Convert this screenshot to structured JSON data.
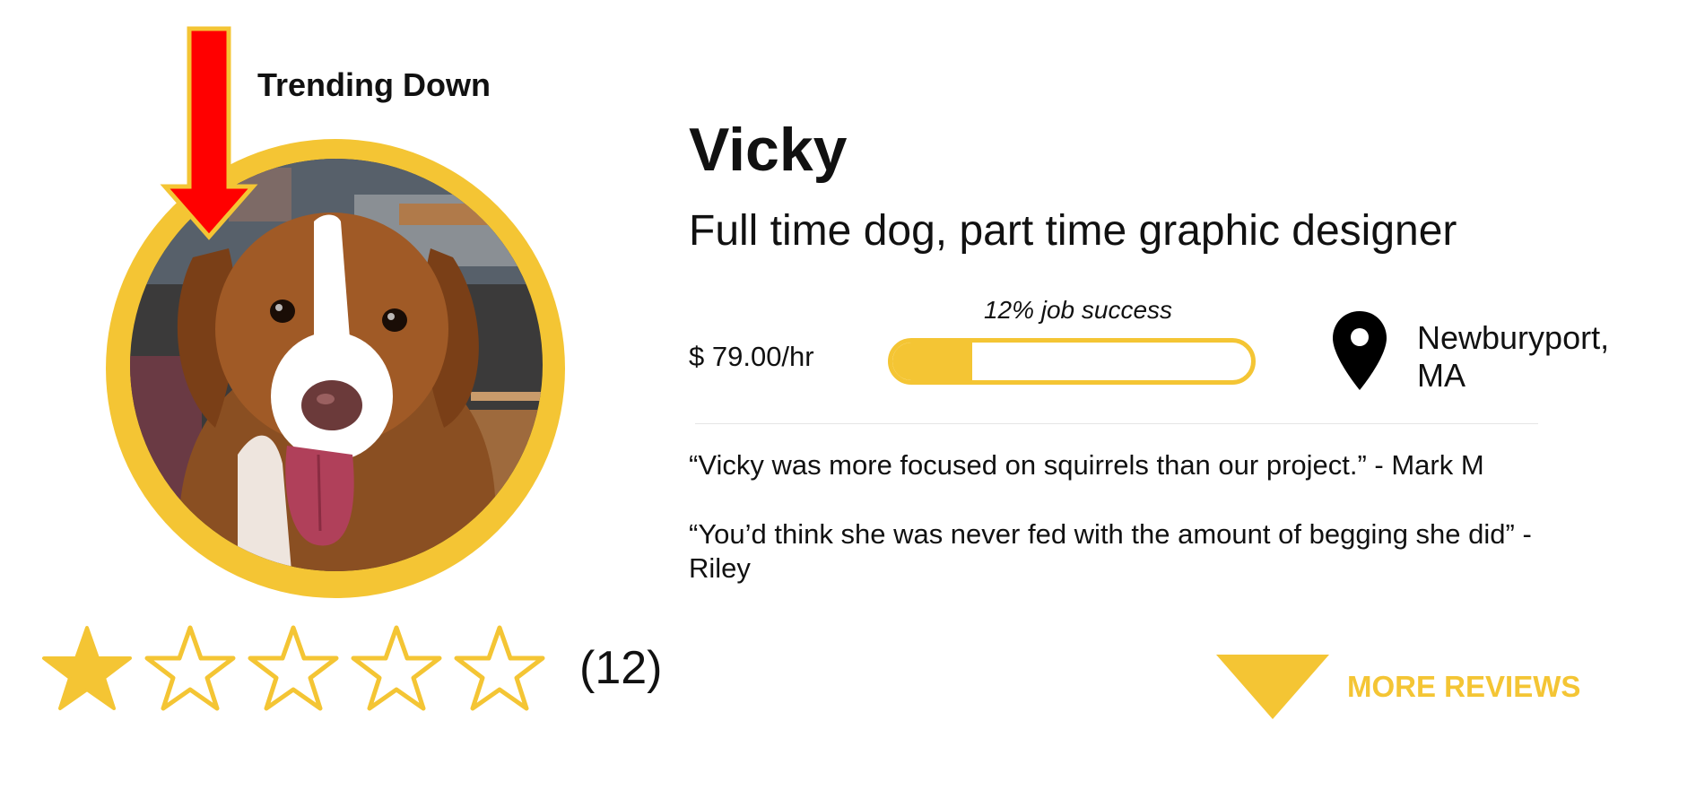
{
  "profile": {
    "name": "Vicky",
    "tagline": "Full time dog, part time graphic designer",
    "rate": "$ 79.00/hr",
    "job_success": {
      "label": "12% job success",
      "percent": 12
    },
    "location": {
      "city": "Newburyport,",
      "state": "MA",
      "icon": "location-pin-icon"
    },
    "avatar_icon": "dog-photo"
  },
  "trend": {
    "label": "Trending Down",
    "icon": "down-arrow-icon",
    "color": "#ff0000"
  },
  "rating": {
    "stars_filled": 1,
    "stars_total": 5,
    "count": "(12)"
  },
  "reviews": [
    {
      "text": "“Vicky was more focused on squirrels than our project.”  - Mark M"
    },
    {
      "text": "“You’d think she was never fed with the amount of begging she did” - Riley"
    }
  ],
  "more_reviews": {
    "label": "MORE REVIEWS",
    "icon": "triangle-down-icon"
  },
  "colors": {
    "accent": "#f4c534",
    "trend": "#ff0000",
    "text": "#111111"
  }
}
